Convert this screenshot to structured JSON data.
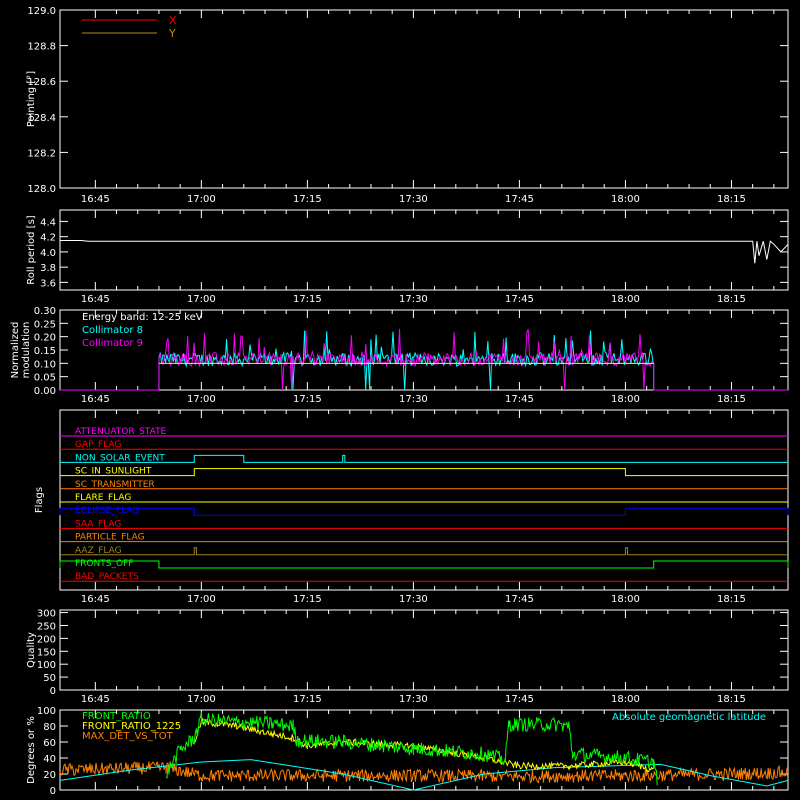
{
  "chart_data": [
    {
      "id": "pointing",
      "type": "line",
      "ylabel": "Pointing [°]",
      "yticks": [
        "128.0",
        "128.2",
        "128.4",
        "128.6",
        "128.8",
        "129.0"
      ],
      "ylim": [
        128.0,
        129.0
      ],
      "xticks": [
        "16:45",
        "17:00",
        "17:15",
        "17:30",
        "17:45",
        "18:00",
        "18:15"
      ],
      "legend": [
        {
          "name": "X",
          "color": "#ff0000"
        },
        {
          "name": "Y",
          "color": "#b09020"
        }
      ],
      "series": [
        {
          "name": "X",
          "color": "#ff0000",
          "x": [
            "16:40",
            "18:23"
          ],
          "y": [
            128.0,
            128.0
          ]
        },
        {
          "name": "Y",
          "color": "#b09020",
          "x": [
            "16:40",
            "18:23"
          ],
          "y": [
            128.0,
            128.0
          ]
        }
      ]
    },
    {
      "id": "roll",
      "type": "line",
      "ylabel": "Roll period [s]",
      "yticks": [
        "3.6",
        "3.8",
        "4.0",
        "4.2",
        "4.4"
      ],
      "ylim": [
        3.5,
        4.55
      ],
      "xticks": [
        "16:45",
        "17:00",
        "17:15",
        "17:30",
        "17:45",
        "18:00",
        "18:15"
      ],
      "series": [
        {
          "name": "roll",
          "color": "#ffffff",
          "x": [
            "16:40",
            "16:43",
            "16:44",
            "17:00",
            "17:30",
            "18:00",
            "18:18",
            "18:18.3",
            "18:18.6",
            "18:18.9",
            "18:19.5",
            "18:20",
            "18:20.5",
            "18:21",
            "18:22",
            "18:23"
          ],
          "y": [
            4.15,
            4.15,
            4.14,
            4.14,
            4.14,
            4.14,
            4.14,
            3.85,
            4.14,
            3.95,
            4.14,
            3.9,
            4.14,
            4.1,
            4.0,
            4.1
          ]
        }
      ]
    },
    {
      "id": "modulation",
      "type": "line",
      "ylabel": "Normalized modulation",
      "yticks": [
        "0.00",
        "0.05",
        "0.10",
        "0.15",
        "0.20",
        "0.25",
        "0.30"
      ],
      "ylim": [
        0.0,
        0.3
      ],
      "xticks": [
        "16:45",
        "17:00",
        "17:15",
        "17:30",
        "17:45",
        "18:00",
        "18:15"
      ],
      "annotations": [
        "Energy band: 12-25 keV"
      ],
      "legend": [
        {
          "name": "Collimator 8",
          "color": "#00ffff"
        },
        {
          "name": "Collimator 9",
          "color": "#ff00ff"
        }
      ],
      "active_range": [
        "16:54",
        "18:04"
      ],
      "baseline": 0.1
    },
    {
      "id": "flags",
      "type": "line",
      "ylabel": "Flags",
      "xticks": [
        "16:45",
        "17:00",
        "17:15",
        "17:30",
        "17:45",
        "18:00",
        "18:15"
      ],
      "flags": [
        {
          "name": "ATTENUATOR_STATE",
          "color": "#ff00ff",
          "segments": []
        },
        {
          "name": "GAP_FLAG",
          "color": "#ff0000",
          "segments": []
        },
        {
          "name": "NON_SOLAR_EVENT",
          "color": "#00ffff",
          "segments": [
            [
              "16:59",
              "17:06"
            ],
            [
              "17:20",
              "17:20.3"
            ]
          ]
        },
        {
          "name": "SC_IN_SUNLIGHT",
          "color": "#ffff00",
          "segments": [
            [
              "16:59",
              "18:00"
            ]
          ]
        },
        {
          "name": "SC_TRANSMITTER",
          "color": "#ff8000",
          "segments": []
        },
        {
          "name": "FLARE_FLAG",
          "color": "#ffff00",
          "segments": []
        },
        {
          "name": "ECLIPSE_FLAG",
          "color": "#0000ff",
          "segments": [
            [
              "16:40",
              "16:59"
            ],
            [
              "18:00",
              "18:23"
            ]
          ]
        },
        {
          "name": "SAA_FLAG",
          "color": "#ff0000",
          "segments": []
        },
        {
          "name": "PARTICLE_FLAG",
          "color": "#ff8000",
          "segments": []
        },
        {
          "name": "AAZ_FLAG",
          "color": "#a08020",
          "segments": [
            [
              "16:59",
              "16:59.3"
            ],
            [
              "18:00",
              "18:00.3"
            ]
          ]
        },
        {
          "name": "FRONTS_OFF",
          "color": "#00ff00",
          "segments": [
            [
              "16:40",
              "16:54"
            ],
            [
              "18:04",
              "18:23"
            ]
          ]
        },
        {
          "name": "BAD_PACKETS",
          "color": "#ff0000",
          "segments": []
        }
      ]
    },
    {
      "id": "quality",
      "type": "line",
      "ylabel": "Quality",
      "yticks": [
        "0",
        "50",
        "100",
        "150",
        "200",
        "250",
        "300"
      ],
      "ylim": [
        0,
        310
      ],
      "xticks": [
        "16:45",
        "17:00",
        "17:15",
        "17:30",
        "17:45",
        "18:00",
        "18:15"
      ],
      "series": []
    },
    {
      "id": "front_ratio",
      "type": "line",
      "ylabel": "Degrees or %",
      "yticks": [
        "0",
        "20",
        "40",
        "60",
        "80",
        "100"
      ],
      "ylim": [
        0,
        100
      ],
      "xticks": [
        "16:45",
        "17:00",
        "17:15",
        "17:30",
        "17:45",
        "18:00",
        "18:15"
      ],
      "legend": [
        {
          "name": "FRONT_RATIO",
          "color": "#00ff00"
        },
        {
          "name": "FRONT_RATIO_1225",
          "color": "#ffff00"
        },
        {
          "name": "MAX_DET_VS_TOT",
          "color": "#ff8000"
        },
        {
          "name": "Absolute geomagnetic latitude",
          "color": "#00ffff"
        }
      ],
      "series": [
        {
          "name": "FRONT_RATIO",
          "color": "#00ff00",
          "x": [
            "16:55",
            "16:57",
            "16:59",
            "17:00",
            "17:05",
            "17:10",
            "17:13",
            "17:13.5",
            "17:20",
            "17:30",
            "17:40",
            "17:43",
            "17:43.5",
            "17:50",
            "17:52",
            "17:52.5",
            "18:00",
            "18:04",
            "18:04.5"
          ],
          "y": [
            20,
            50,
            65,
            88,
            85,
            83,
            80,
            62,
            60,
            52,
            45,
            38,
            82,
            82,
            80,
            45,
            40,
            35,
            12
          ]
        },
        {
          "name": "FRONT_RATIO_1225",
          "color": "#ffff00",
          "x": [
            "16:59",
            "17:00",
            "17:05",
            "17:10",
            "17:13",
            "17:15",
            "17:20",
            "17:30",
            "17:40",
            "17:45",
            "17:52",
            "18:00",
            "18:04"
          ],
          "y": [
            60,
            85,
            80,
            70,
            65,
            55,
            60,
            55,
            40,
            30,
            30,
            35,
            25
          ]
        },
        {
          "name": "MAX_DET_VS_TOT",
          "color": "#ff8000",
          "x": [
            "16:40",
            "16:55",
            "17:00",
            "17:15",
            "17:30",
            "17:45",
            "18:00",
            "18:15",
            "18:23"
          ],
          "y": [
            25,
            28,
            18,
            18,
            18,
            17,
            18,
            20,
            22
          ]
        },
        {
          "name": "Absolute geomagnetic latitude",
          "color": "#00ffff",
          "x": [
            "16:40",
            "16:50",
            "17:00",
            "17:07",
            "17:20",
            "17:30",
            "17:40",
            "17:50",
            "18:05",
            "18:12",
            "18:20",
            "18:23"
          ],
          "y": [
            12,
            25,
            35,
            38,
            20,
            0,
            20,
            28,
            32,
            18,
            5,
            12
          ]
        }
      ]
    }
  ]
}
